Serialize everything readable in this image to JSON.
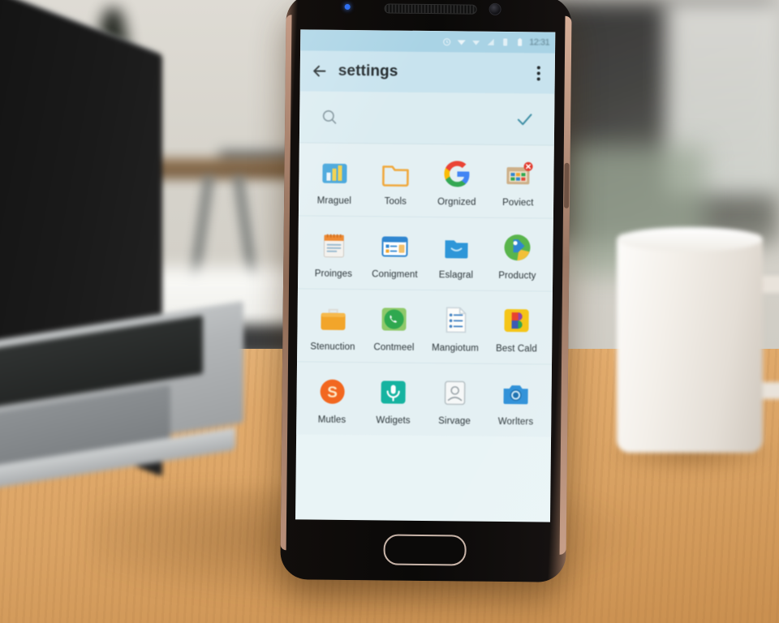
{
  "scene": {
    "description": "smartphone on wooden desk",
    "background_objects": [
      "laptop",
      "coffee-mug",
      "shelf",
      "plant",
      "desk"
    ],
    "desk_color": "#dca366",
    "phone_frame_color": "#0a0908",
    "phone_metal_color": "#b88f79"
  },
  "phone": {
    "statusbar": {
      "time": "12:31",
      "background": "#a9d3e5",
      "icons": [
        "alarm-icon",
        "wifi-icon",
        "wifi-icon",
        "signal-icon",
        "sim-icon",
        "battery-icon"
      ]
    },
    "appbar": {
      "title": "settings",
      "back_label": "back",
      "menu_label": "more options",
      "background": "#c8e3ee"
    },
    "search": {
      "value": "",
      "placeholder": "",
      "confirm_label": "done",
      "accent": "#3f8fa5"
    },
    "grid": {
      "rows": [
        {
          "apps": [
            {
              "label": "Mraguel",
              "icon": "bar-chart-icon",
              "color": "#4aa8dd"
            },
            {
              "label": "Tools",
              "icon": "folder-icon",
              "color": "#f0a83c"
            },
            {
              "label": "Orgnized",
              "icon": "google-g-icon",
              "color": "#4285f4"
            },
            {
              "label": "Poviect",
              "icon": "calendar-badge-icon",
              "color": "#c9a882",
              "badge": true
            }
          ]
        },
        {
          "apps": [
            {
              "label": "Proinges",
              "icon": "notepad-icon",
              "color": "#ef8b34"
            },
            {
              "label": "Conigment",
              "icon": "window-icon",
              "color": "#2f86d0"
            },
            {
              "label": "Eslagral",
              "icon": "blue-folder-icon",
              "color": "#2e96d8"
            },
            {
              "label": "Producty",
              "icon": "play-circle-icon",
              "color": "#59b54c"
            }
          ]
        },
        {
          "apps": [
            {
              "label": "Stenuction",
              "icon": "orange-folder-icon",
              "color": "#f2a52a"
            },
            {
              "label": "Contmeel",
              "icon": "phone-chat-icon",
              "color": "#2fa84f"
            },
            {
              "label": "Mangiotum",
              "icon": "document-list-icon",
              "color": "#3d7fc1"
            },
            {
              "label": "Best Cald",
              "icon": "letter-p-icon",
              "color": "#f5c518"
            }
          ]
        },
        {
          "apps": [
            {
              "label": "Mutles",
              "icon": "circle-s-icon",
              "color": "#f2671f"
            },
            {
              "label": "Wdigets",
              "icon": "microphone-icon",
              "color": "#16b3a0"
            },
            {
              "label": "Sirvage",
              "icon": "contact-card-icon",
              "color": "#9aa3a8"
            },
            {
              "label": "Worlters",
              "icon": "camera-icon",
              "color": "#2e90d8"
            }
          ]
        }
      ]
    },
    "hardware": {
      "home_button_label": "home",
      "earpiece_label": "earpiece",
      "camera_label": "front camera",
      "led_label": "notification LED",
      "side_button_label": "power button"
    }
  }
}
